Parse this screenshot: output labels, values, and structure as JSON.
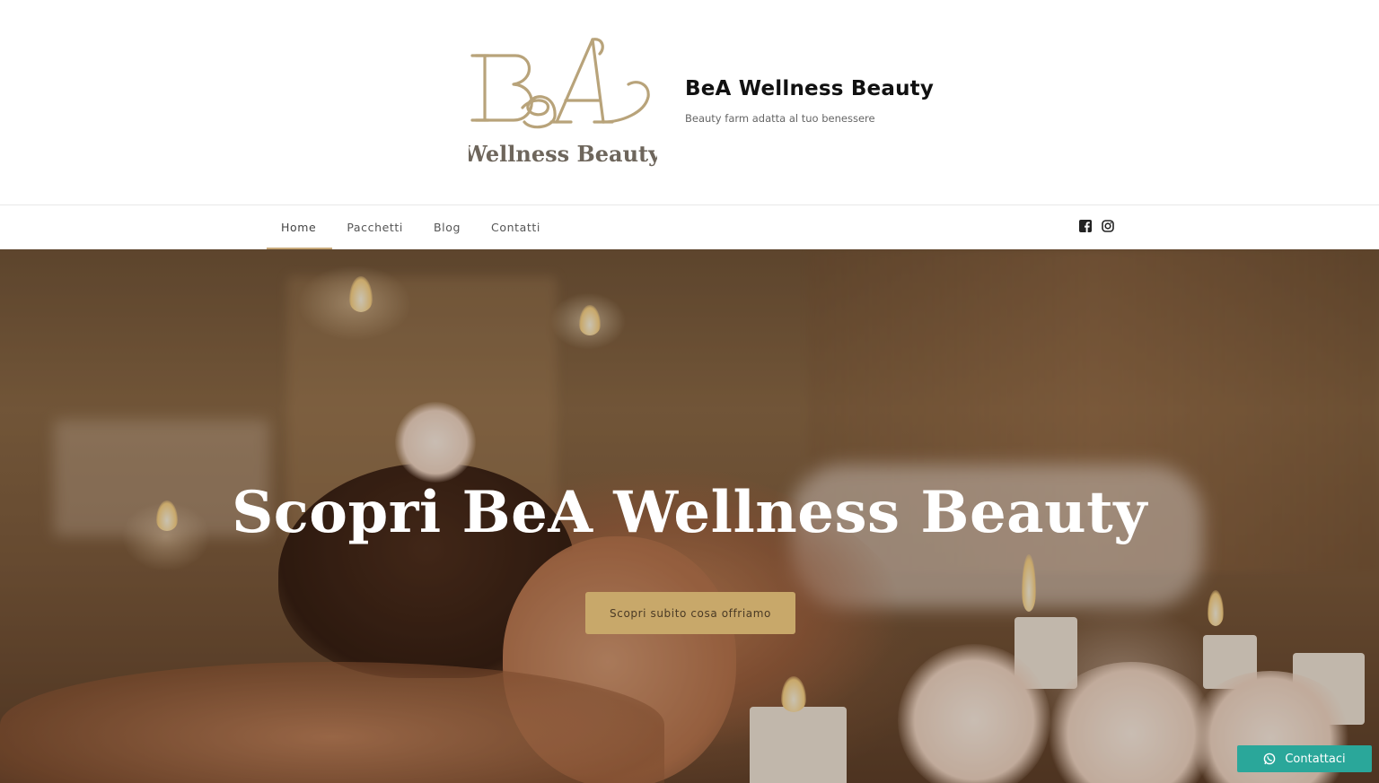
{
  "header": {
    "logo": {
      "monogram": "BeA",
      "wordmark": "Wellness Beauty",
      "color": "#b8a37a"
    },
    "site_title": "BeA Wellness Beauty",
    "tagline": "Beauty farm adatta al tuo benessere"
  },
  "nav": {
    "items": [
      {
        "label": "Home",
        "active": true
      },
      {
        "label": "Pacchetti",
        "active": false
      },
      {
        "label": "Blog",
        "active": false
      },
      {
        "label": "Contatti",
        "active": false
      }
    ],
    "active_color": "#c8a97a",
    "social": [
      {
        "name": "facebook-icon"
      },
      {
        "name": "instagram-icon"
      }
    ]
  },
  "hero": {
    "title": "Scopri BeA Wellness Beauty",
    "button_label": "Scopri subito cosa offriamo",
    "button_color": "#c8a86a"
  },
  "floating_contact": {
    "label": "Contattaci",
    "icon": "whatsapp-icon",
    "color": "#2aa79a"
  }
}
